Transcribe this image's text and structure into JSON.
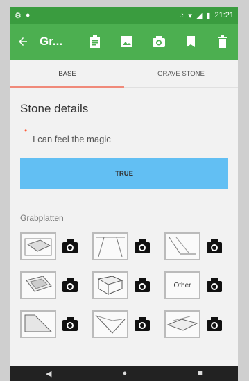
{
  "status": {
    "time": "21:21"
  },
  "appbar": {
    "title": "Gr...",
    "icons": [
      "back-arrow-icon",
      "clipboard-icon",
      "image-icon",
      "camera-icon",
      "bookmark-icon",
      "trash-icon"
    ]
  },
  "tabs": [
    {
      "label": "BASE",
      "active": true
    },
    {
      "label": "GRAVE STONE",
      "active": false
    }
  ],
  "stone_details": {
    "title": "Stone details",
    "field_value": "I can feel the magic",
    "required_mark": "•",
    "button_label": "TRUE"
  },
  "grabplatten": {
    "label": "Grabplatten",
    "items": [
      {
        "thumb_text": ""
      },
      {
        "thumb_text": ""
      },
      {
        "thumb_text": ""
      },
      {
        "thumb_text": ""
      },
      {
        "thumb_text": ""
      },
      {
        "thumb_text": "Other"
      },
      {
        "thumb_text": ""
      },
      {
        "thumb_text": ""
      },
      {
        "thumb_text": ""
      }
    ]
  },
  "colors": {
    "status": "#3a9c3f",
    "appbar": "#4caf50",
    "accent_tab": "#f08a7a",
    "button": "#62bff3"
  }
}
